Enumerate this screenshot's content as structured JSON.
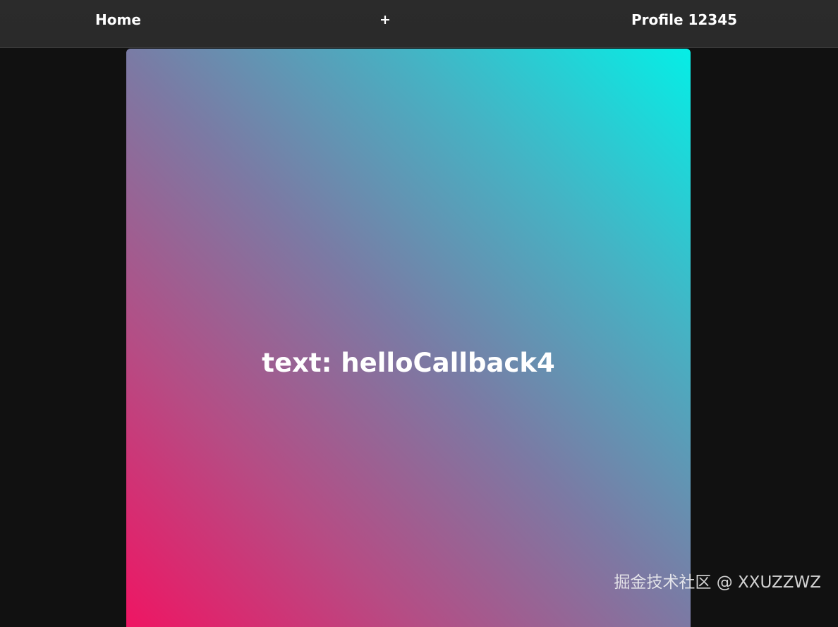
{
  "nav": {
    "home_label": "Home",
    "add_label": "+",
    "profile_label": "Profile 12345"
  },
  "card": {
    "text": "text: helloCallback4"
  },
  "watermark": {
    "text": "掘金技术社区 @ XXUZZWZ"
  },
  "colors": {
    "topbar": "#2a2a2a",
    "page_background": "#111111",
    "gradient_start": "#ef1563",
    "gradient_end": "#05eee6",
    "text": "#ffffff"
  }
}
